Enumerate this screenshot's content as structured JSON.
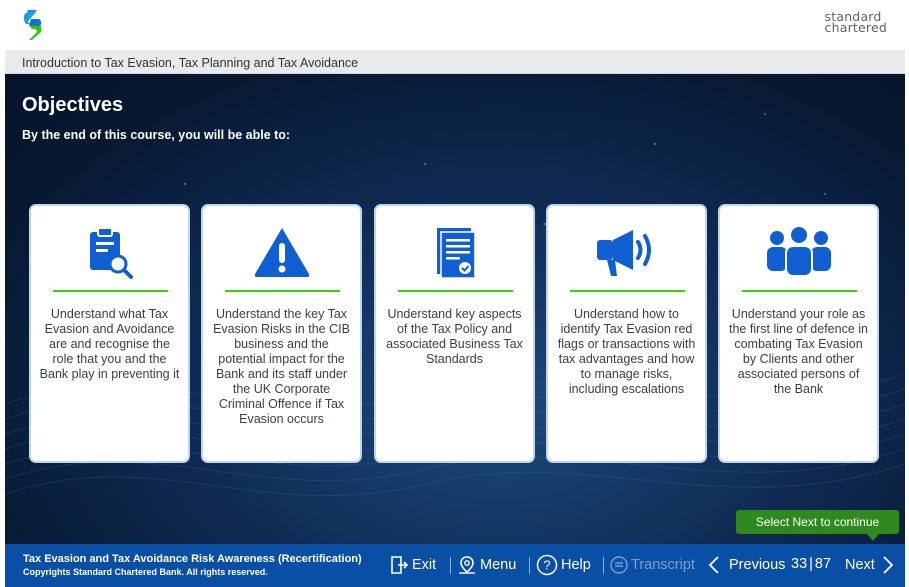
{
  "brand": {
    "line1": "standard",
    "line2": "chartered"
  },
  "course_title": "Introduction to Tax Evasion, Tax Planning and Tax Avoidance",
  "heading": "Objectives",
  "subheading": "By the end of this course, you will be able to:",
  "cards": [
    {
      "icon": "clipboard-search-icon",
      "text": "Understand what Tax Evasion and Avoidance are and recognise the role that you and the Bank play in preventing it"
    },
    {
      "icon": "warning-icon",
      "text": "Understand the key Tax Evasion Risks in the CIB business and the potential impact for the Bank and its staff under the UK Corporate Criminal Offence if Tax Evasion occurs"
    },
    {
      "icon": "document-check-icon",
      "text": "Understand key aspects of the Tax Policy and associated Business Tax Standards"
    },
    {
      "icon": "megaphone-icon",
      "text": "Understand how to identify Tax Evasion red flags or transactions with tax advantages and how to manage risks, including escalations"
    },
    {
      "icon": "people-group-icon",
      "text": "Understand your role as the first line of defence in combating Tax Evasion by Clients and other associated persons of the Bank"
    }
  ],
  "hint": "Select Next to continue",
  "footer": {
    "title": "Tax Evasion and Tax Avoidance Risk Awareness (Recertification)",
    "copyright": "Copyrights Standard Chartered Bank. All rights reserved.",
    "exit": "Exit",
    "menu": "Menu",
    "help": "Help",
    "transcript": "Transcript",
    "previous": "Previous",
    "page_current": "33",
    "page_total": "87",
    "next": "Next"
  },
  "colors": {
    "accent_green": "#38d200",
    "footer_blue": "#0a4fa6",
    "icon_blue": "#1060d4",
    "hint_green": "#2e8a1f"
  }
}
